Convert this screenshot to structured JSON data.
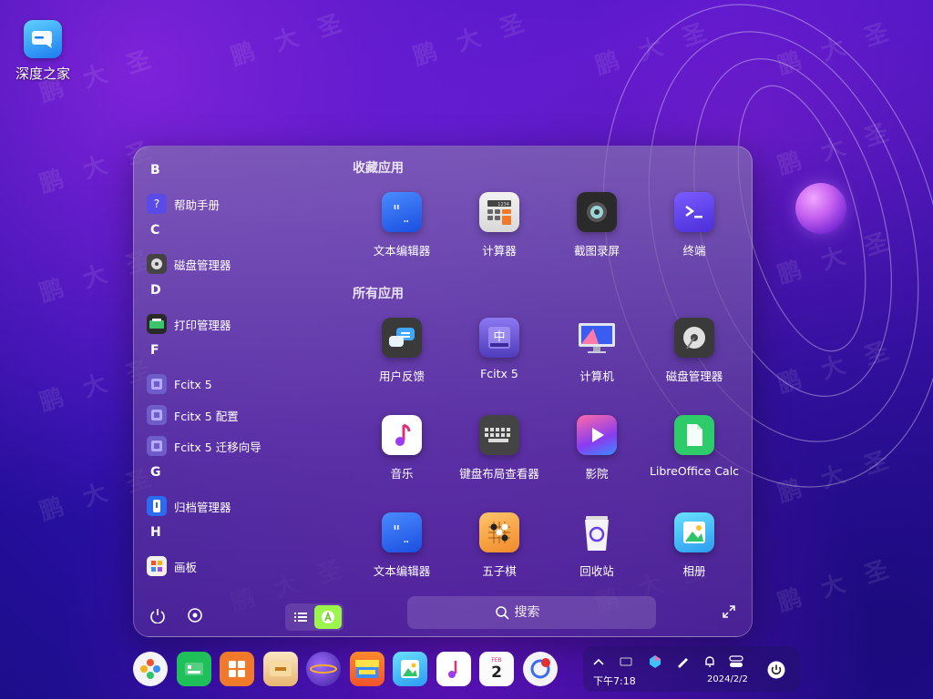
{
  "desktop": {
    "icon_label": "深度之家"
  },
  "watermark_text": "鹏大圣",
  "launcher": {
    "sidebar": {
      "groups": [
        {
          "letter": "B",
          "items": [
            {
              "label": "帮助手册",
              "icon": "help-manual-icon"
            }
          ]
        },
        {
          "letter": "C",
          "items": [
            {
              "label": "磁盘管理器",
              "icon": "disk-manager-icon"
            }
          ]
        },
        {
          "letter": "D",
          "items": [
            {
              "label": "打印管理器",
              "icon": "print-manager-icon"
            }
          ]
        },
        {
          "letter": "F",
          "items": [
            {
              "label": "Fcitx 5",
              "icon": "fcitx-icon"
            },
            {
              "label": "Fcitx 5 配置",
              "icon": "fcitx-config-icon"
            },
            {
              "label": "Fcitx 5 迁移向导",
              "icon": "fcitx-migrator-icon"
            }
          ]
        },
        {
          "letter": "G",
          "items": [
            {
              "label": "归档管理器",
              "icon": "archive-manager-icon"
            }
          ]
        },
        {
          "letter": "H",
          "items": [
            {
              "label": "画板",
              "icon": "drawing-board-icon"
            }
          ]
        }
      ]
    },
    "favorites_title": "收藏应用",
    "favorites": [
      {
        "name": "文本编辑器",
        "icon": "text-editor-icon"
      },
      {
        "name": "计算器",
        "icon": "calculator-icon"
      },
      {
        "name": "截图录屏",
        "icon": "screenshot-icon"
      },
      {
        "name": "终端",
        "icon": "terminal-icon"
      }
    ],
    "all_title": "所有应用",
    "all_apps": [
      {
        "name": "用户反馈",
        "icon": "feedback-icon"
      },
      {
        "name": "Fcitx 5",
        "icon": "fcitx-icon"
      },
      {
        "name": "计算机",
        "icon": "computer-icon"
      },
      {
        "name": "磁盘管理器",
        "icon": "disk-manager-icon"
      },
      {
        "name": "音乐",
        "icon": "music-icon"
      },
      {
        "name": "键盘布局查看器",
        "icon": "keyboard-layout-icon"
      },
      {
        "name": "影院",
        "icon": "movie-icon"
      },
      {
        "name": "LibreOffice Calc",
        "icon": "libreoffice-calc-icon"
      },
      {
        "name": "文本编辑器",
        "icon": "text-editor-icon"
      },
      {
        "name": "五子棋",
        "icon": "gomoku-icon"
      },
      {
        "name": "回收站",
        "icon": "trash-icon"
      },
      {
        "name": "相册",
        "icon": "album-icon"
      }
    ],
    "search_placeholder": "搜索",
    "calc_display": "1234"
  },
  "dock": {
    "items": [
      "launcher-icon",
      "file-manager-icon",
      "control-center-icon",
      "archive-icon",
      "browser-icon",
      "app-store-icon",
      "album-icon",
      "music-icon",
      "calendar-icon",
      "ocr-icon"
    ],
    "calendar_month": "FEB",
    "calendar_day": "2"
  },
  "tray": {
    "time": "下午7:18",
    "date": "2024/2/2"
  },
  "colors": {
    "accent_green": "#9cf54a",
    "bg_purple": "#4a16c4"
  }
}
